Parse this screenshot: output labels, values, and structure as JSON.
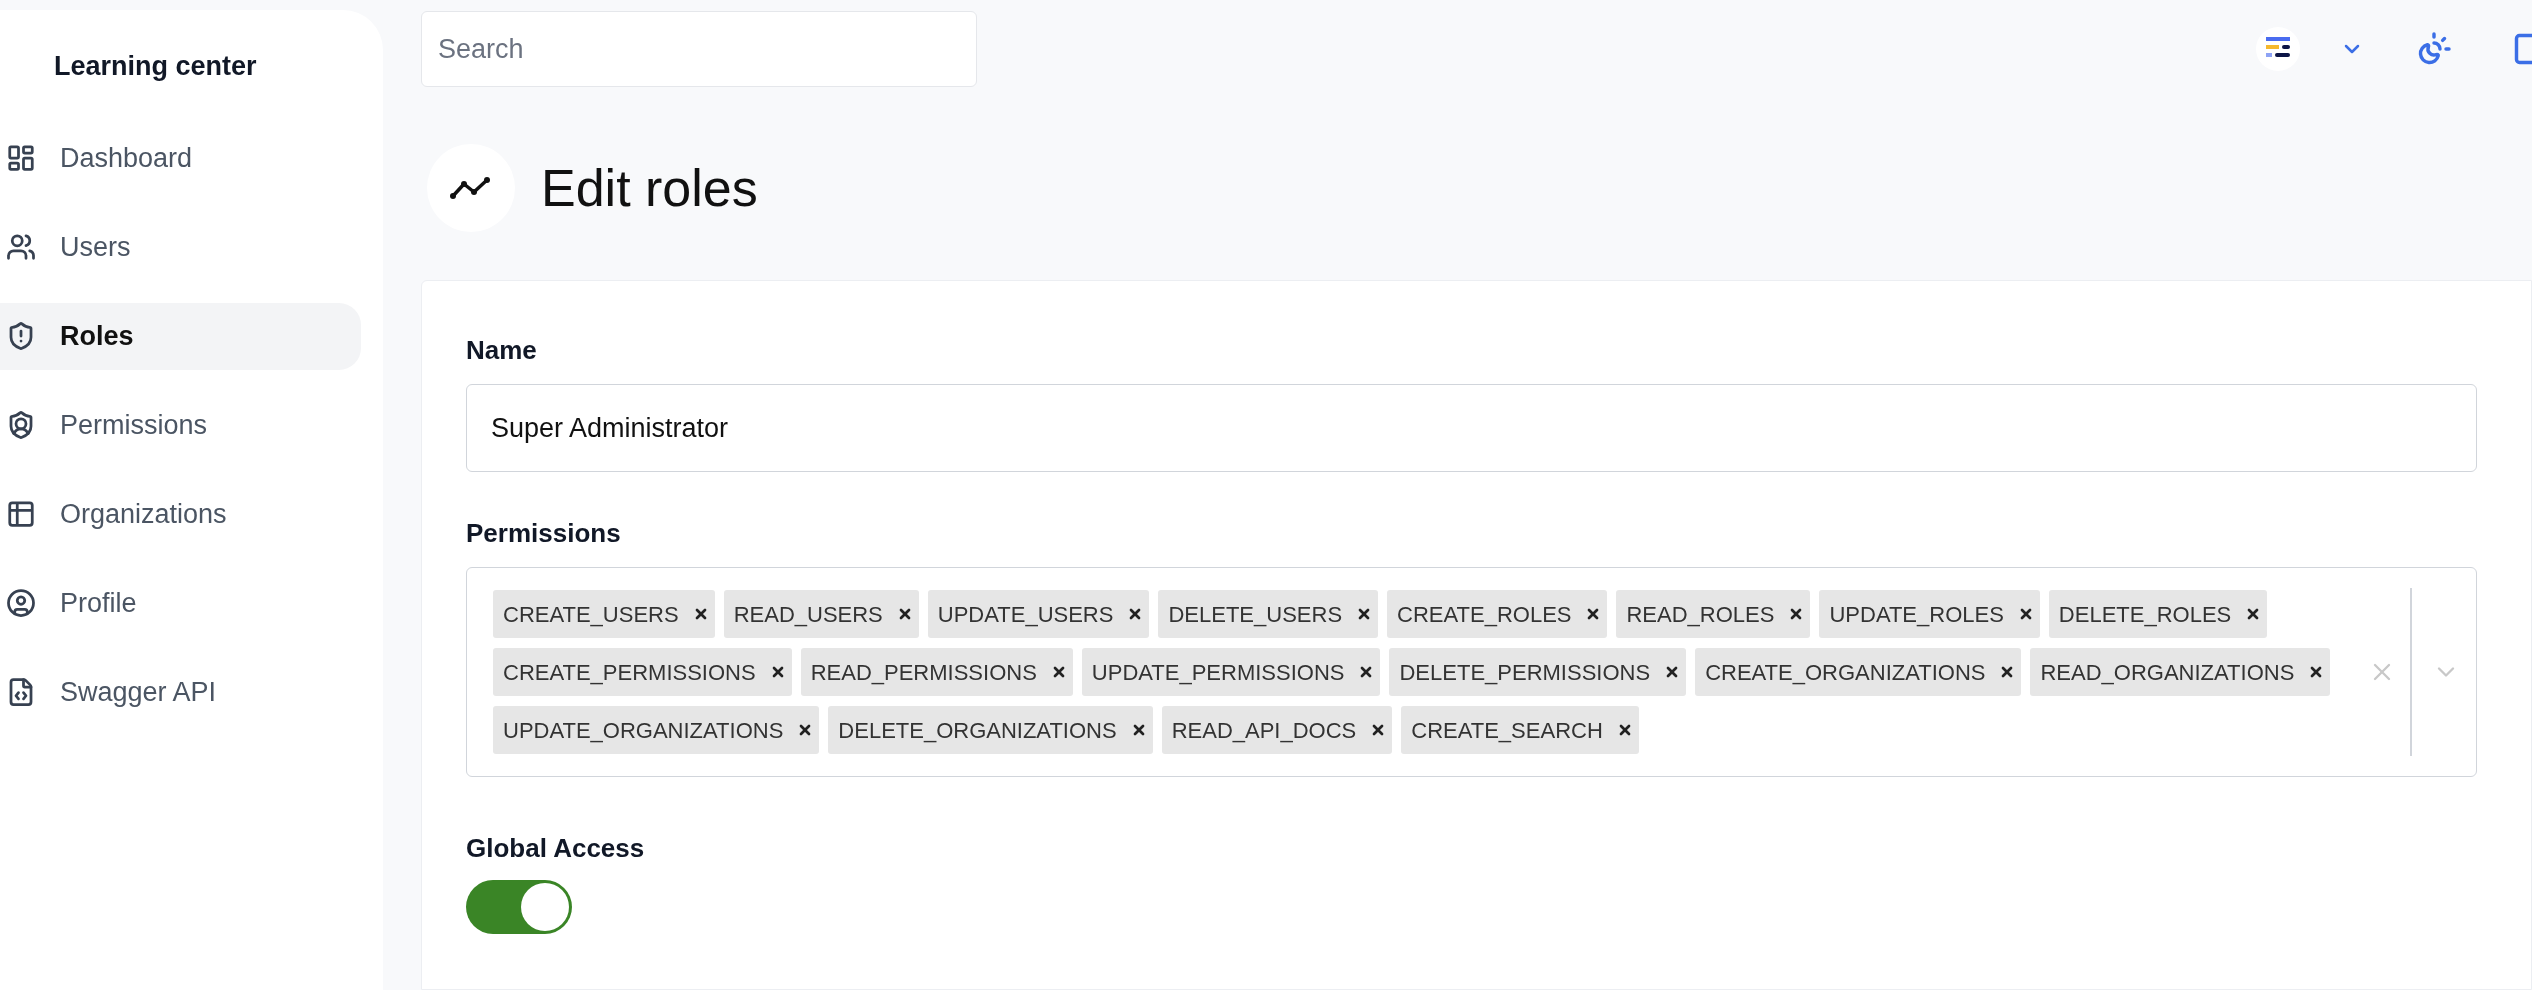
{
  "sidebar": {
    "title": "Learning center",
    "items": [
      {
        "label": "Dashboard",
        "selected": false
      },
      {
        "label": "Users",
        "selected": false
      },
      {
        "label": "Roles",
        "selected": true
      },
      {
        "label": "Permissions",
        "selected": false
      },
      {
        "label": "Organizations",
        "selected": false
      },
      {
        "label": "Profile",
        "selected": false
      },
      {
        "label": "Swagger API",
        "selected": false
      }
    ]
  },
  "search": {
    "placeholder": "Search"
  },
  "page": {
    "title": "Edit roles"
  },
  "form": {
    "name": {
      "label": "Name",
      "value": "Super Administrator"
    },
    "permissions": {
      "label": "Permissions",
      "tags": [
        "CREATE_USERS",
        "READ_USERS",
        "UPDATE_USERS",
        "DELETE_USERS",
        "CREATE_ROLES",
        "READ_ROLES",
        "UPDATE_ROLES",
        "DELETE_ROLES",
        "CREATE_PERMISSIONS",
        "READ_PERMISSIONS",
        "UPDATE_PERMISSIONS",
        "DELETE_PERMISSIONS",
        "CREATE_ORGANIZATIONS",
        "READ_ORGANIZATIONS",
        "UPDATE_ORGANIZATIONS",
        "DELETE_ORGANIZATIONS",
        "READ_API_DOCS",
        "CREATE_SEARCH"
      ]
    },
    "global_access": {
      "label": "Global Access",
      "on": true
    }
  }
}
